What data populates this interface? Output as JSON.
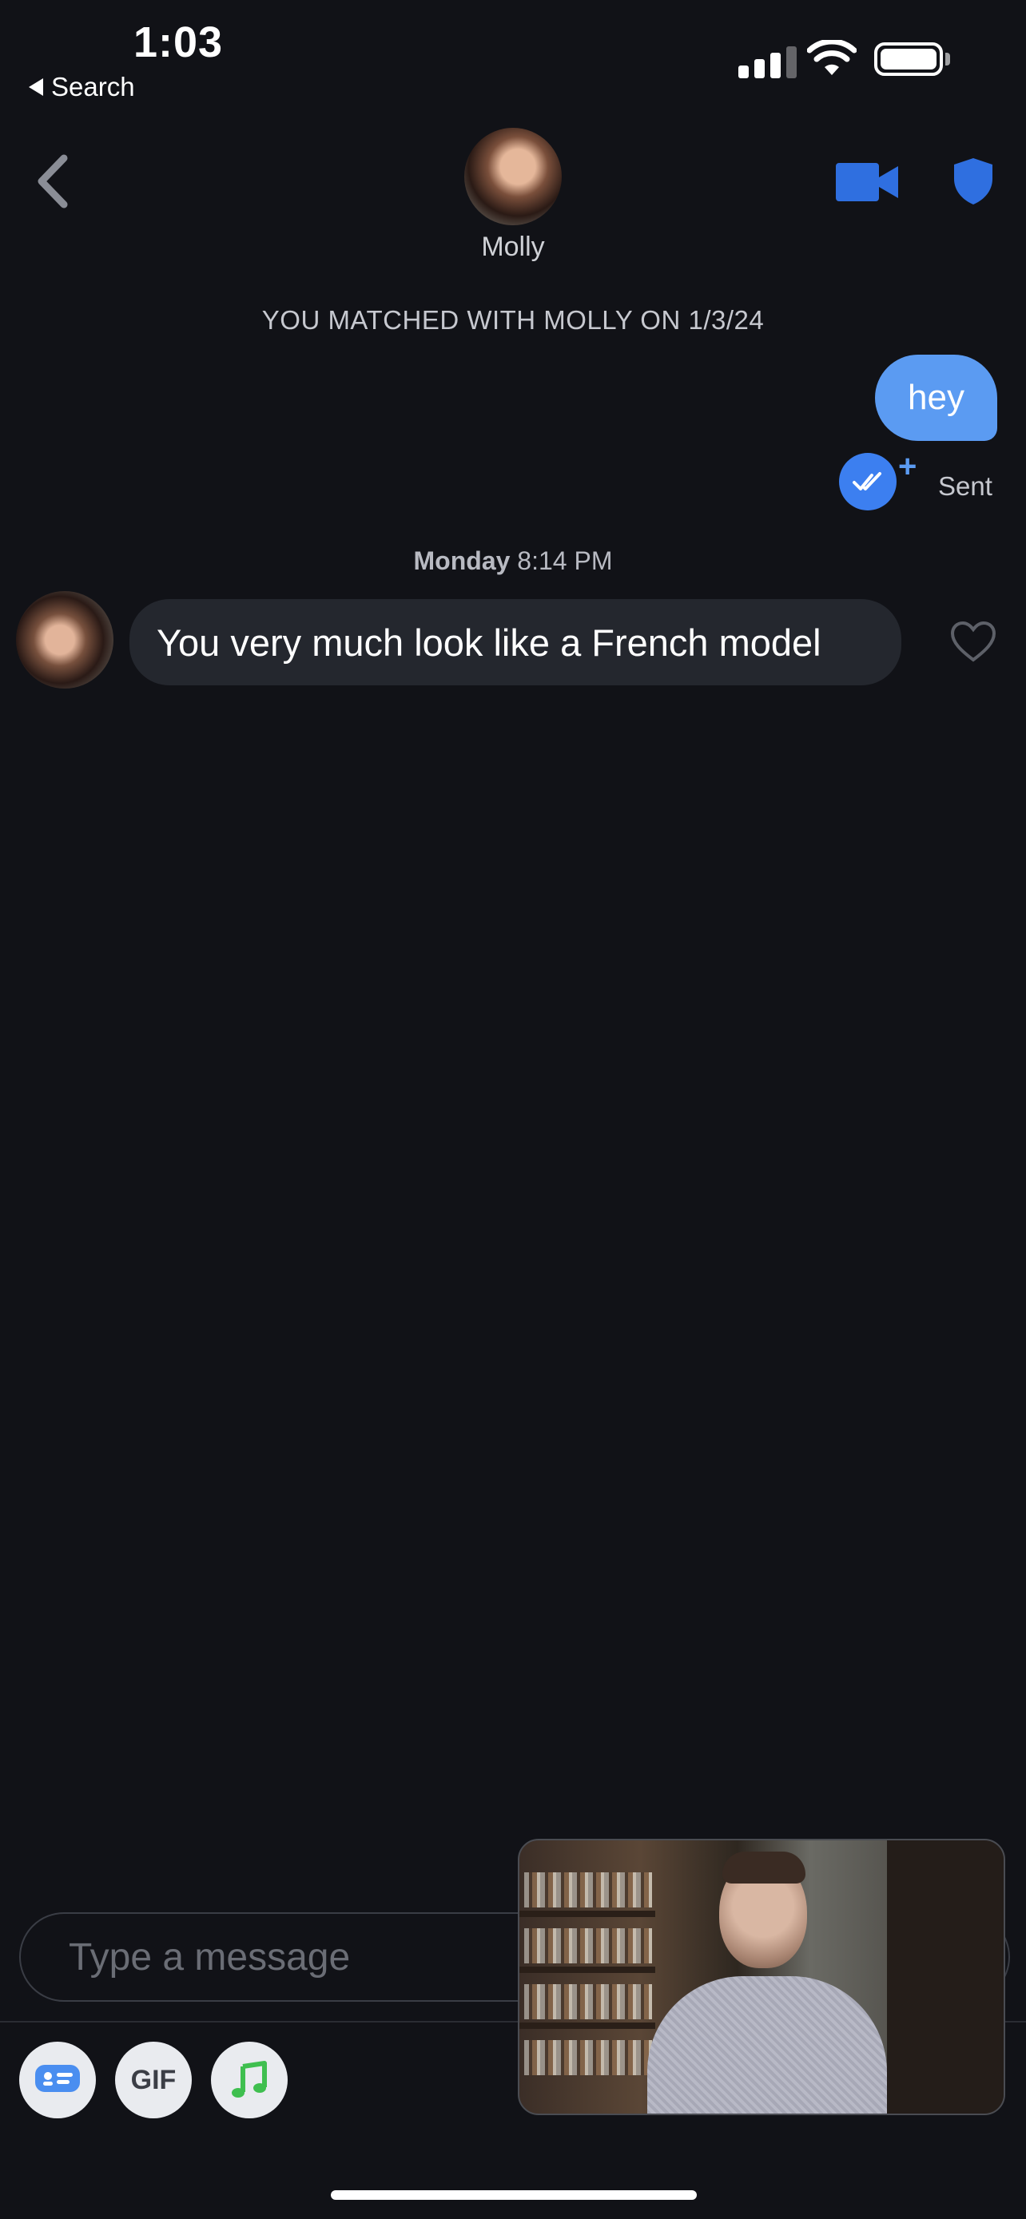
{
  "status_bar": {
    "time": "1:03",
    "back_app": "Search"
  },
  "header": {
    "match_name": "Molly"
  },
  "conversation": {
    "match_banner": "YOU MATCHED WITH MOLLY ON 1/3/24",
    "outgoing": {
      "text": "hey",
      "status": "Sent"
    },
    "day_label": "Monday",
    "day_time": "8:14 PM",
    "incoming": {
      "text": "You very much look like a French model"
    }
  },
  "composer": {
    "placeholder": "Type a message",
    "gif_label": "GIF"
  },
  "colors": {
    "background": "#111217",
    "accent_blue": "#5b9bf2",
    "incoming_bubble": "#24272e"
  },
  "icons": [
    "back-chevron-icon",
    "video-call-icon",
    "safety-shield-icon",
    "read-receipt-icon",
    "heart-icon",
    "sticker-icon",
    "music-icon"
  ]
}
